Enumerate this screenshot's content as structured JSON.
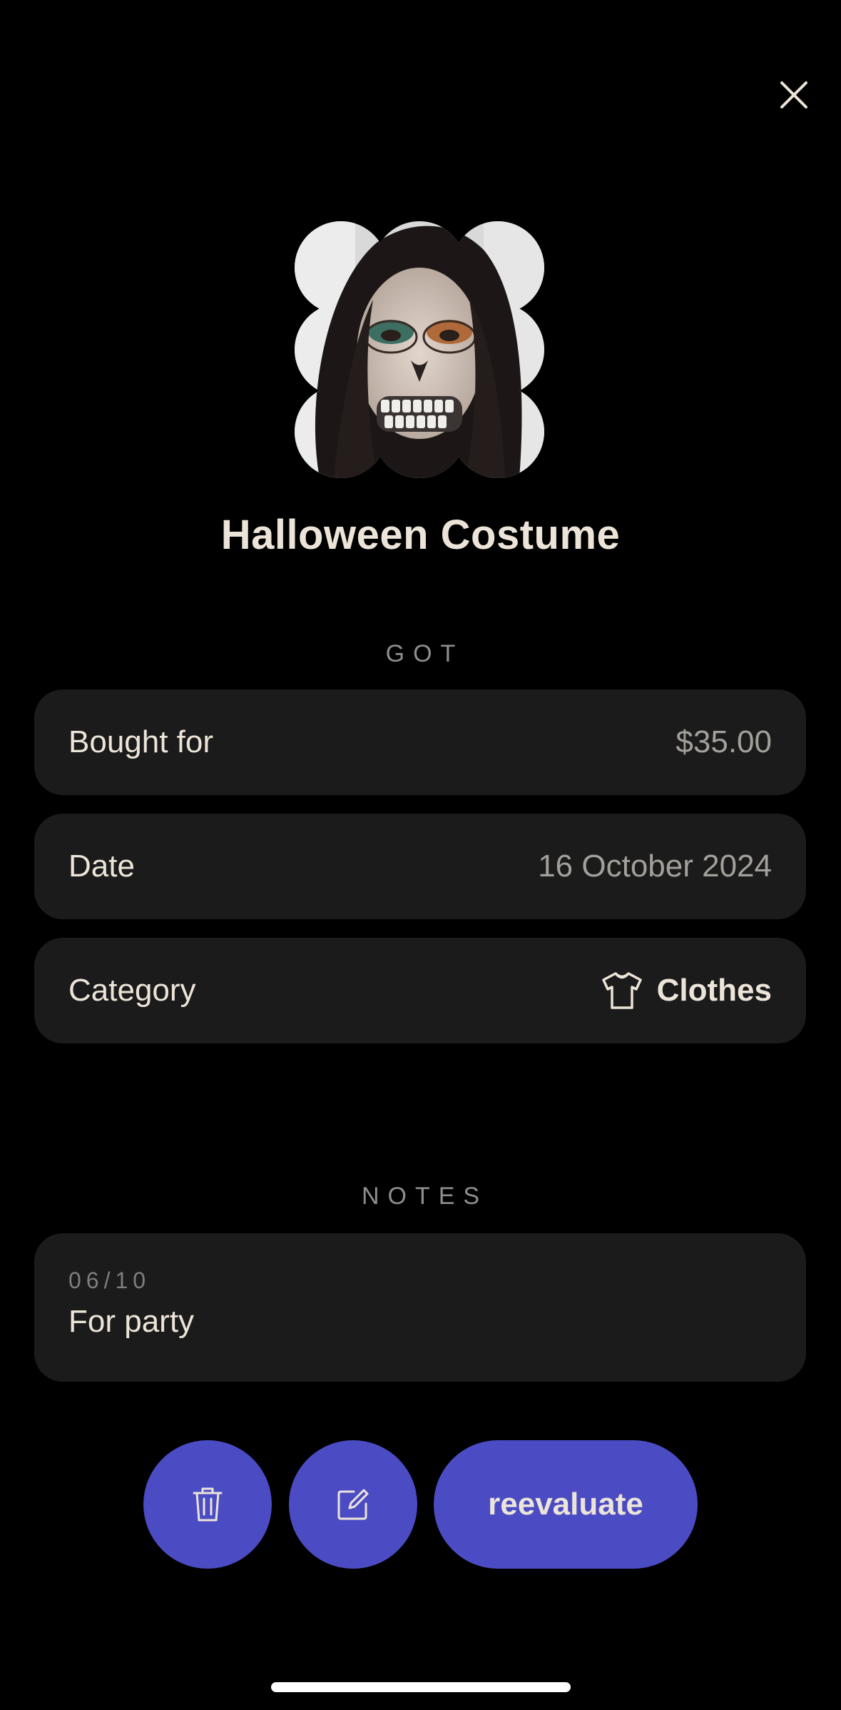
{
  "header": {
    "close_icon": "close-icon"
  },
  "item": {
    "title": "Halloween Costume",
    "image_icon": "skull-face-photo"
  },
  "got": {
    "section_label": "GOT",
    "bought_for_label": "Bought for",
    "bought_for_value": "$35.00",
    "date_label": "Date",
    "date_value": "16 October 2024",
    "category_label": "Category",
    "category_value": "Clothes",
    "category_icon": "tshirt-icon"
  },
  "notes": {
    "section_label": "NOTES",
    "entries": [
      {
        "date": "06/10",
        "text": "For party"
      }
    ]
  },
  "actions": {
    "delete_icon": "trash-icon",
    "edit_icon": "edit-icon",
    "reevaluate_label": "reevaluate"
  },
  "colors": {
    "background": "#000000",
    "card": "#1b1b1b",
    "accent": "#4b4cc4",
    "text_primary": "#ece4d8",
    "text_secondary": "#a3a09b"
  }
}
